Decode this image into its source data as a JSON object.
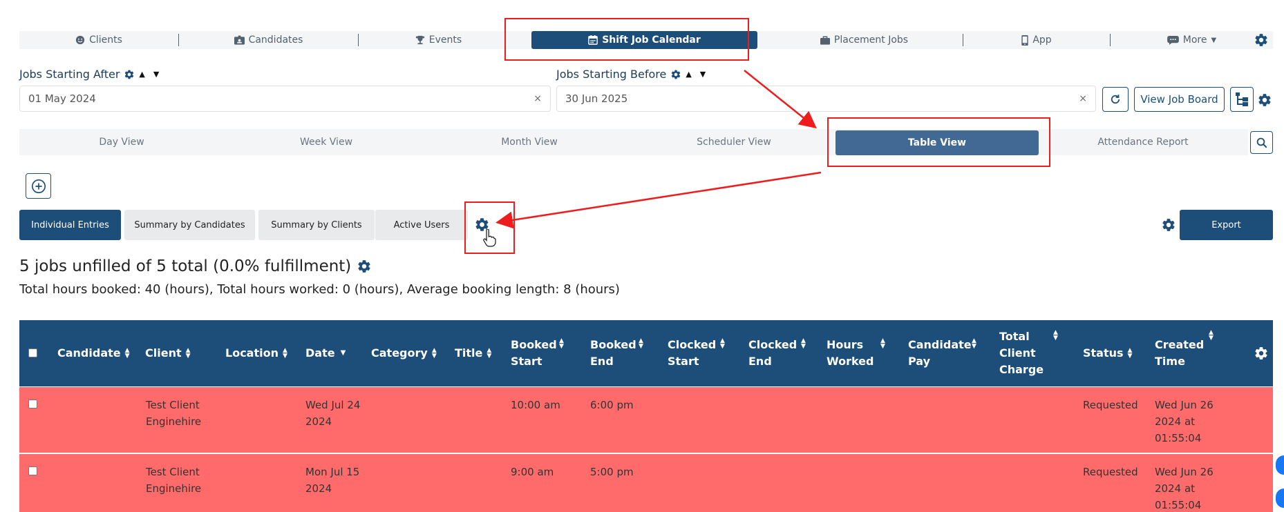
{
  "nav": {
    "items": [
      {
        "label": "Clients",
        "icon": "smiley-icon"
      },
      {
        "label": "Candidates",
        "icon": "id-badge-icon"
      },
      {
        "label": "Events",
        "icon": "trophy-icon"
      },
      {
        "label": "Shift Job Calendar",
        "icon": "calendar-icon"
      },
      {
        "label": "Placement Jobs",
        "icon": "briefcase-icon"
      },
      {
        "label": "App",
        "icon": "mobile-icon"
      },
      {
        "label": "More",
        "icon": "message-icon"
      }
    ]
  },
  "filters": {
    "after_label": "Jobs Starting After",
    "after_value": "01 May 2024",
    "before_label": "Jobs Starting Before",
    "before_value": "30 Jun 2025",
    "clear": "×",
    "view_job_board": "View Job Board"
  },
  "views": {
    "tabs": [
      "Day View",
      "Week View",
      "Month View",
      "Scheduler View",
      "Table View",
      "Attendance Report"
    ]
  },
  "subtabs": {
    "items": [
      "Individual Entries",
      "Summary by Candidates",
      "Summary by Clients",
      "Active Users"
    ],
    "export": "Export"
  },
  "summary": {
    "title": "5 jobs unfilled of 5 total (0.0% fulfillment)",
    "subtitle": "Total hours booked: 40 (hours), Total hours worked: 0 (hours), Average booking length: 8 (hours)"
  },
  "table": {
    "columns": [
      "Candidate",
      "Client",
      "Location",
      "Date",
      "Category",
      "Title",
      "Booked Start",
      "Booked End",
      "Clocked Start",
      "Clocked End",
      "Hours Worked",
      "Candidate Pay",
      "Total Client Charge",
      "Status",
      "Created Time"
    ],
    "rows": [
      {
        "client": "Test Client Enginehire",
        "date": "Wed Jul 24 2024",
        "booked_start": "10:00 am",
        "booked_end": "6:00 pm",
        "status": "Requested",
        "created": "Wed Jun 26 2024 at 01:55:04"
      },
      {
        "client": "Test Client Enginehire",
        "date": "Mon Jul 15 2024",
        "booked_start": "9:00 am",
        "booked_end": "5:00 pm",
        "status": "Requested",
        "created": "Wed Jun 26 2024 at 01:55:04"
      }
    ]
  },
  "colors": {
    "primary": "#1d4e79",
    "tab_active": "#426994",
    "row_unfilled": "#ff6b6b",
    "annotation": "#ee1c1c"
  }
}
